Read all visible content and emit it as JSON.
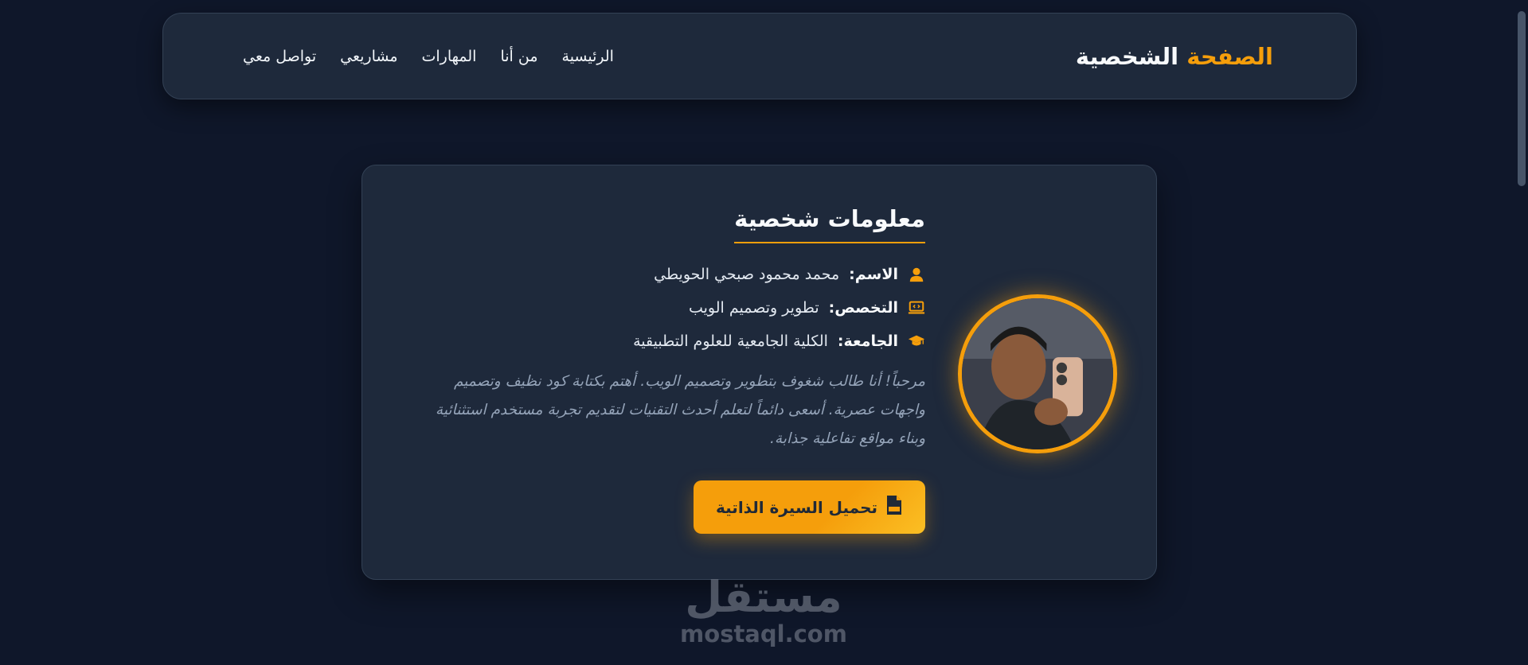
{
  "header": {
    "brand_accent": "الصفحة",
    "brand_main": "الشخصية",
    "nav": [
      {
        "label": "الرئيسية"
      },
      {
        "label": "من أنا"
      },
      {
        "label": "المهارات"
      },
      {
        "label": "مشاريعي"
      },
      {
        "label": "تواصل معي"
      }
    ]
  },
  "profile": {
    "title": "معلومات شخصية",
    "name_label": "الاسم:",
    "name_value": "محمد محمود صبحي الحويطي",
    "spec_label": "التخصص:",
    "spec_value": "تطوير وتصميم الويب",
    "uni_label": "الجامعة:",
    "uni_value": "الكلية الجامعية للعلوم التطبيقية",
    "bio": "مرحباً! أنا طالب شغوف بتطوير وتصميم الويب. أهتم بكتابة كود نظيف وتصميم واجهات عصرية. أسعى دائماً لتعلم أحدث التقنيات لتقديم تجربة مستخدم استثنائية وبناء مواقع تفاعلية جذابة.",
    "cv_button": "تحميل السيرة الذاتية"
  },
  "watermark": {
    "arabic": "مستقل",
    "latin": "mostaql.com"
  },
  "colors": {
    "accent": "#f59e0b",
    "background": "#0f172a",
    "surface": "#1e293b"
  },
  "icons": {
    "name": "user-icon",
    "spec": "laptop-code-icon",
    "uni": "graduation-cap-icon",
    "cv": "file-pdf-icon"
  }
}
